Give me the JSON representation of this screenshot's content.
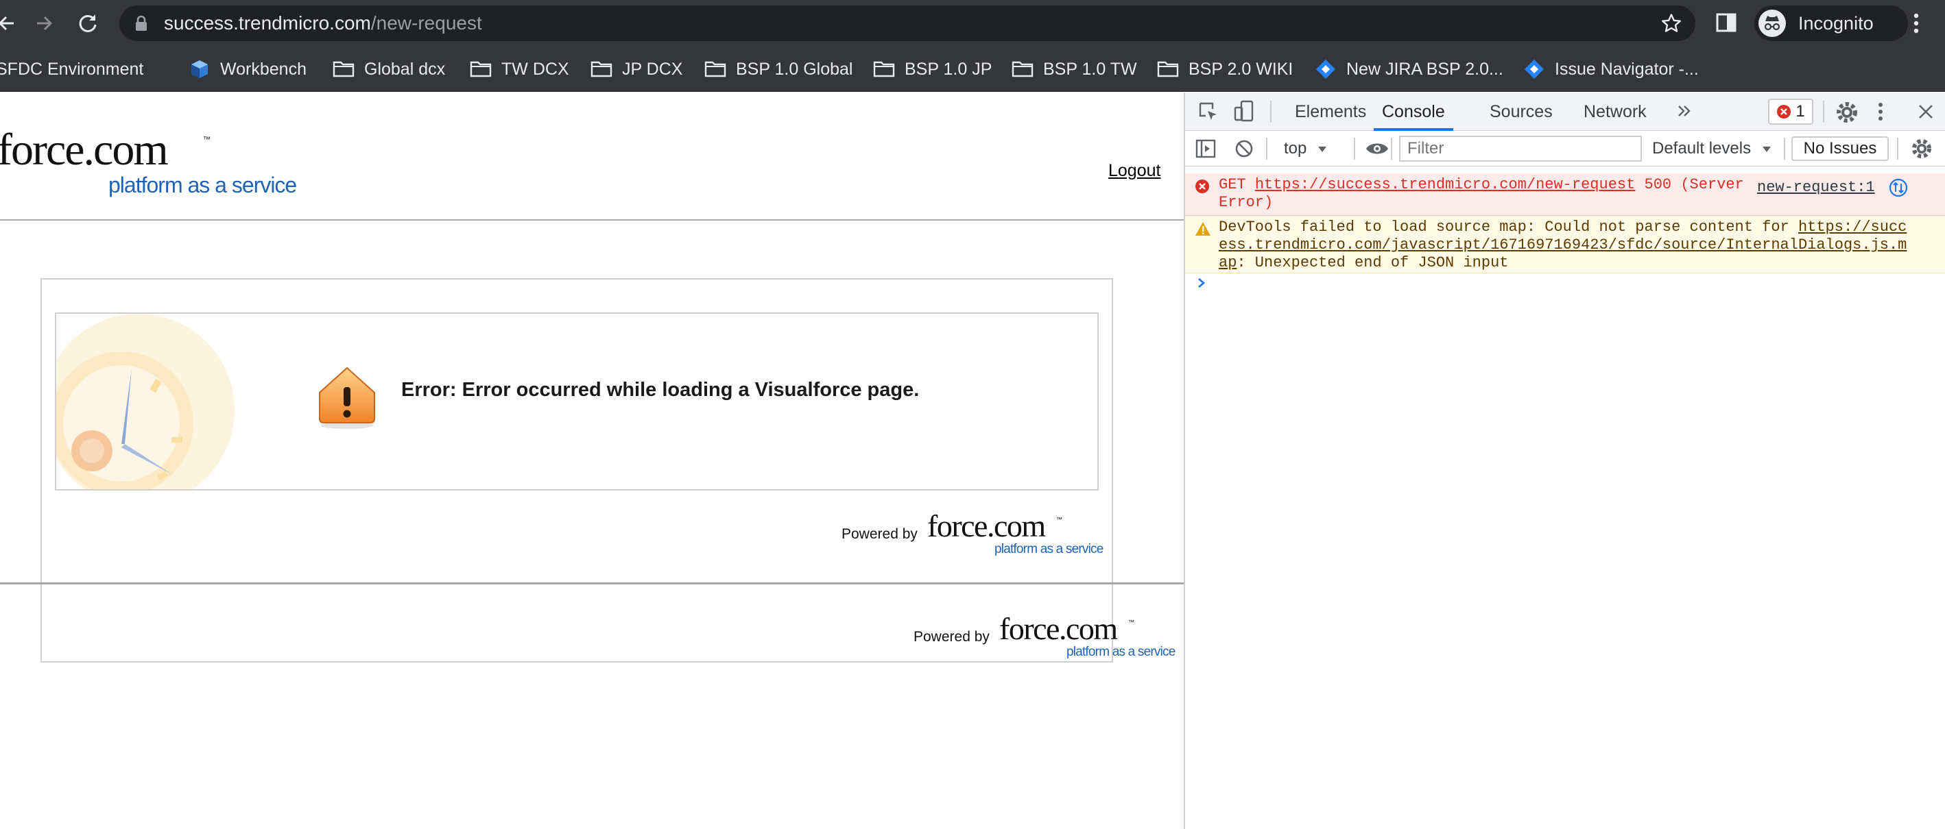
{
  "browser": {
    "url_host": "success.trendmicro.com",
    "url_path": "/new-request",
    "profile_label": "Incognito",
    "bookmarks": [
      {
        "label": "SFDC Environment",
        "icon": "folder-icon"
      },
      {
        "label": "Workbench",
        "icon": "cube-icon"
      },
      {
        "label": "Global dcx",
        "icon": "folder-icon"
      },
      {
        "label": "TW DCX",
        "icon": "folder-icon"
      },
      {
        "label": "JP DCX",
        "icon": "folder-icon"
      },
      {
        "label": "BSP 1.0 Global",
        "icon": "folder-icon"
      },
      {
        "label": "BSP 1.0 JP",
        "icon": "folder-icon"
      },
      {
        "label": "BSP 1.0 TW",
        "icon": "folder-icon"
      },
      {
        "label": "BSP 2.0 WIKI",
        "icon": "folder-icon"
      },
      {
        "label": "New JIRA BSP 2.0...",
        "icon": "jira-icon"
      },
      {
        "label": "Issue Navigator -...",
        "icon": "jira-icon"
      }
    ]
  },
  "page": {
    "logo_text": "force.com",
    "logo_tagline": "platform as a service",
    "logout_label": "Logout",
    "error_message": "Error: Error occurred while loading a Visualforce page.",
    "powered_by_label": "Powered by",
    "powered_logo_text": "force.com",
    "powered_logo_tagline": "platform as a service"
  },
  "devtools": {
    "tabs": [
      "Elements",
      "Console",
      "Sources",
      "Network"
    ],
    "active_tab": "Console",
    "error_count": "1",
    "context": "top",
    "filter_placeholder": "Filter",
    "levels_label": "Default levels",
    "issues_label": "No Issues",
    "messages": {
      "error": {
        "method": "GET",
        "url": "https://success.trendmicro.com/new-request",
        "status_line1": "500 (Server",
        "status_line2": "Error)",
        "source": "new-request:1"
      },
      "warning": {
        "prefix": "DevTools failed to load source map: Could not parse content for ",
        "url_line1": "https://succ",
        "url_line2": "ess.trendmicro.com/javascript/1671697169423/sfdc/source/InternalDialogs.js.m",
        "url_line3": "ap",
        "suffix": ": Unexpected end of JSON input"
      }
    }
  },
  "colors": {
    "chrome_bg": "#35363a",
    "omnibox_bg": "#202124",
    "force_blue": "#1f63b5",
    "devtools_accent": "#1a73e8",
    "error_red": "#d93025",
    "warning_amber": "#e2a50b"
  }
}
